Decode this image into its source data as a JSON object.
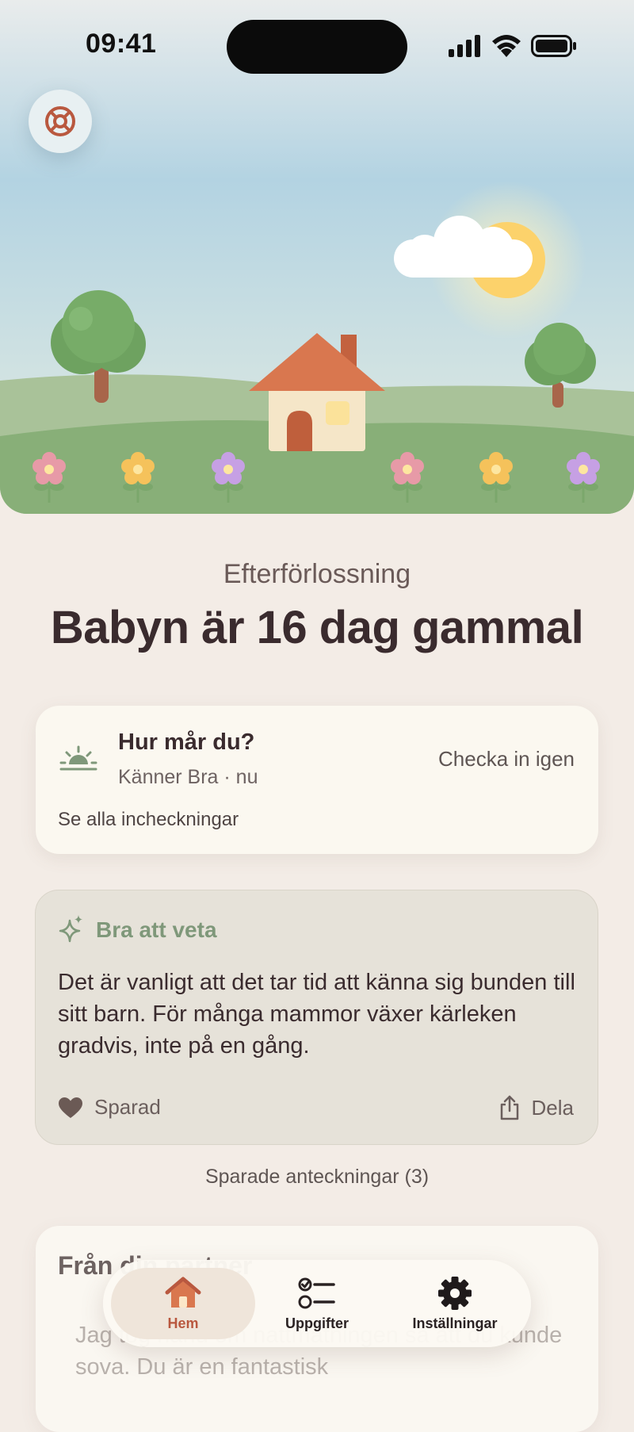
{
  "status_bar": {
    "time": "09:41"
  },
  "hero": {
    "help_icon": "lifebuoy-icon"
  },
  "header": {
    "phase": "Efterförlossning",
    "title": "Babyn är 16 dag gammal"
  },
  "checkin_card": {
    "icon": "sunrise-icon",
    "title": "Hur mår du?",
    "subtitle": "Känner Bra · nu",
    "action_label": "Checka in igen",
    "link_label": "Se alla incheckningar"
  },
  "tip_card": {
    "icon": "sparkle-icon",
    "title": "Bra att veta",
    "body": "Det är vanligt att det tar tid att känna sig bunden till sitt barn. För många mammor växer kärleken gradvis, inte på en gång.",
    "saved_label": "Sparad",
    "share_label": "Dela"
  },
  "notes_link": "Sparade anteckningar (3)",
  "partner_card": {
    "title": "Från din partner",
    "body": "Jag tog hand om nattmatningen så att du kunde sova. Du är en fantastisk"
  },
  "tabbar": {
    "tabs": [
      {
        "label": "Hem",
        "icon": "home-icon",
        "active": true
      },
      {
        "label": "Uppgifter",
        "icon": "checklist-icon",
        "active": false
      },
      {
        "label": "Inställningar",
        "icon": "gear-icon",
        "active": false
      }
    ]
  },
  "colors": {
    "background": "#f3ece6",
    "accent": "#b9583f",
    "tip_accent": "#7f987a",
    "text_primary": "#3a2b2e"
  }
}
